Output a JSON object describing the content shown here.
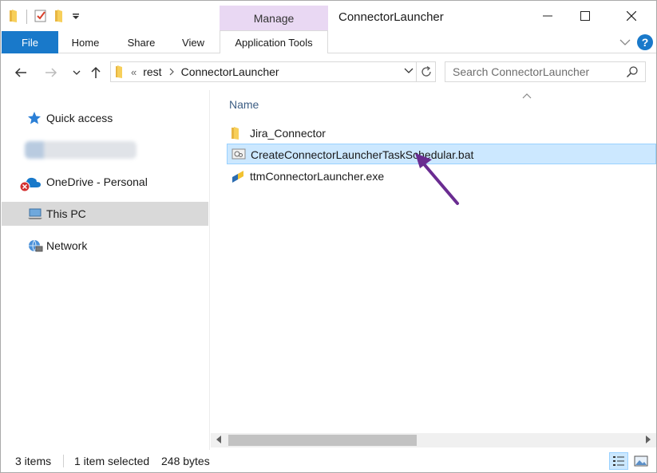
{
  "window": {
    "title": "ConnectorLauncher",
    "contextual_tab": "Manage"
  },
  "ribbon": {
    "tabs": [
      {
        "label": "File"
      },
      {
        "label": "Home"
      },
      {
        "label": "Share"
      },
      {
        "label": "View"
      },
      {
        "label": "Application Tools"
      }
    ]
  },
  "address": {
    "overflow": "«",
    "crumbs": [
      "rest",
      "ConnectorLauncher"
    ]
  },
  "search": {
    "placeholder": "Search ConnectorLauncher"
  },
  "nav": {
    "items": [
      {
        "label": "Quick access",
        "icon": "star-icon"
      },
      {
        "label": "OneDrive - Personal",
        "icon": "cloud-icon"
      },
      {
        "label": "This PC",
        "icon": "computer-icon",
        "selected": true
      },
      {
        "label": "Network",
        "icon": "network-icon"
      }
    ]
  },
  "content": {
    "column_header": "Name",
    "files": [
      {
        "name": "Jira_Connector",
        "icon": "folder-icon"
      },
      {
        "name": "CreateConnectorLauncherTaskSchedular.bat",
        "icon": "batch-file-icon",
        "selected": true
      },
      {
        "name": "ttmConnectorLauncher.exe",
        "icon": "exe-file-icon"
      }
    ]
  },
  "status": {
    "item_count": "3 items",
    "selection": "1 item selected",
    "size": "248 bytes"
  },
  "colors": {
    "accent": "#1979ca",
    "selection": "#cce8ff",
    "manage_tab": "#e9d8f3",
    "annotation_arrow": "#6a2c91"
  }
}
